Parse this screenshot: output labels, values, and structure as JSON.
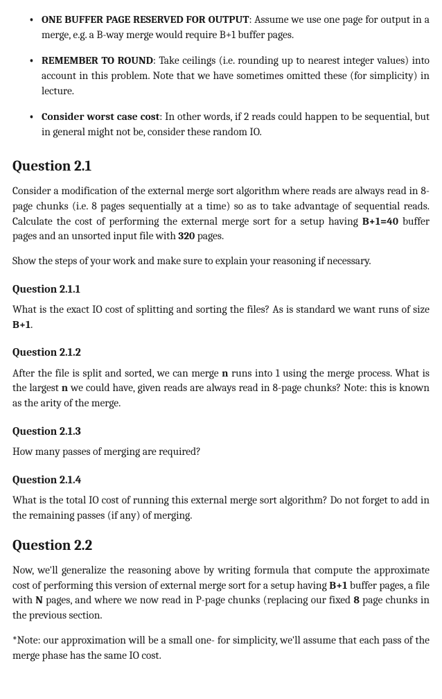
{
  "bullets": [
    {
      "bold": "ONE BUFFER PAGE RESERVED FOR OUTPUT",
      "rest": ": Assume we use one page for output in a merge, e.g. a B-way merge would require B+1 buffer pages."
    },
    {
      "bold": "REMEMBER TO ROUND",
      "rest": ": Take ceilings (i.e. rounding up to nearest integer values) into account in this problem. Note that we have sometimes omitted these (for simplicity) in lecture."
    },
    {
      "bold": "Consider worst case cost",
      "rest": ": In other words, if 2 reads could happen to be sequential, but in general might not be, consider these random IO."
    }
  ],
  "q21": {
    "heading": "Question 2.1",
    "para1_pre": "Consider a modification of the external merge sort algorithm where reads are always read in 8-page chunks (i.e. 8 pages sequentially at a time) so as to take advantage of sequential reads. Calculate the cost of performing the external merge sort for a setup having ",
    "para1_b1": "B+1=40",
    "para1_mid": " buffer pages and an unsorted input file with ",
    "para1_b2": "320",
    "para1_post": " pages.",
    "para2": "Show the steps of your work and make sure to explain your reasoning if necessary."
  },
  "q211": {
    "heading": "Question 2.1.1",
    "text_pre": "What is the exact IO cost of splitting and sorting the files? As is standard we want runs of size ",
    "b1": "B+1",
    "text_post": "."
  },
  "q212": {
    "heading": "Question 2.1.2",
    "text_pre": "After the file is split and sorted, we can merge ",
    "b1": "n",
    "text_mid": " runs into 1 using the merge process. What is the largest ",
    "b2": "n",
    "text_post": " we could have, given reads are always read in 8-page chunks? Note: this is known as the arity of the merge."
  },
  "q213": {
    "heading": "Question 2.1.3",
    "text": "How many passes of merging are required?"
  },
  "q214": {
    "heading": "Question 2.1.4",
    "text": "What is the total IO cost of running this external merge sort algorithm? Do not forget to add in the remaining passes (if any) of merging."
  },
  "q22": {
    "heading": "Question 2.2",
    "para1_pre": "Now, we'll generalize the reasoning above by writing formula that compute the approximate cost of performing this version of external merge sort for a setup having ",
    "b1": "B+1",
    "mid1": " buffer pages, a file with ",
    "b2": "N",
    "mid2": " pages, and where we now read in P-page chunks (replacing our fixed ",
    "b3": "8",
    "post": " page chunks in the previous section.",
    "para2": "*Note: our approximation will be a small one- for simplicity, we'll assume that each pass of the merge phase has the same IO cost."
  }
}
